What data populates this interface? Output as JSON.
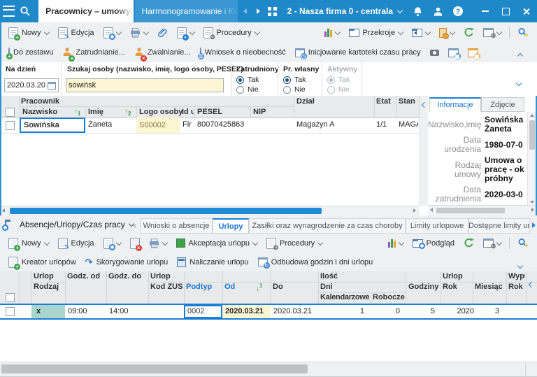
{
  "colors": {
    "titlebar": "#1e88c8",
    "accent": "#1a7fd4",
    "link_header": "#1976d2",
    "row_highlight_yellow": "#fcf6d4",
    "teal_cell": "#a9d6ce",
    "toolbar_bg": "#eef0f2",
    "grid_header_bg": "#e9eaeb",
    "sort_green": "#2f9e4e"
  },
  "titlebar": {
    "tab_active": "Pracownicy – umowy(etaty)",
    "tab_inactive": "Harmonogramowanie i Kontrola RI",
    "company": "2 - Nasza firma 0 - centrala"
  },
  "toolbar_main": {
    "nowy": "Nowy",
    "edycja": "Edycja",
    "procedury": "Procedury",
    "przekroje": "Przekroje"
  },
  "actionbar_main": {
    "do_zestawu": "Do zestawu",
    "zatrudnianie": "Zatrudnianie...",
    "zwalnianie": "Zwalnianie...",
    "wniosek": "Wniosek o nieobecność",
    "inicjowanie": "Inicjowanie kartoteki czasu pracy"
  },
  "filters": {
    "na_dzien": {
      "label": "Na dzień",
      "value": "2020.03.20"
    },
    "szukaj": {
      "label": "Szukaj osoby (nazwisko, imię, logo osoby, PESEL)",
      "value": "sowińsk"
    },
    "zatrudniony": {
      "label": "Zatrudniony",
      "tak": "Tak",
      "nie": "Nie",
      "selected": "Tak"
    },
    "pr_wlasny": {
      "label": "Pr. własny",
      "tak": "Tak",
      "nie": "Nie",
      "selected": "Tak"
    },
    "aktywny": {
      "label": "Aktywny",
      "tak": "Tak",
      "nie": "Nie",
      "selected": "Tak",
      "disabled": true
    }
  },
  "employees_grid": {
    "group_header": "Pracownik",
    "col_nazwisko": "Nazwisko",
    "col_imie": "Imię",
    "col_logo": "Logo osoby",
    "col_id": "Id u",
    "col_pesel": "PESEL",
    "col_nip": "NIP",
    "col_dzial": "Dział",
    "col_etat": "Etat",
    "col_stan": "Stan",
    "sort1": "1",
    "sort2": "2",
    "row": {
      "nazwisko": "Sowińska",
      "imie": "Żaneta",
      "logo": "S00002",
      "id": "Fir",
      "pesel": "80070425863",
      "nip": "",
      "dzial": "Magazyn A",
      "etat": "1/1",
      "stan": "MAGAZ"
    }
  },
  "info_panel": {
    "tab_informacje": "Informacje",
    "tab_zdjecie": "Zdjęcie",
    "fields": [
      {
        "label": "Nazwisko,imię",
        "value": "Sowińska Żaneta"
      },
      {
        "label": "Data urodzenia",
        "value": "1980-07-0"
      },
      {
        "label": "Rodzaj umowy",
        "value": "Umowa o pracę - ok próbny"
      },
      {
        "label": "Data zatrudnienia",
        "value": "2020-03-0"
      }
    ]
  },
  "bottom_section": {
    "title": "Absencje/Urlopy/Czas pracy",
    "tabs": [
      "Wnioski o absencje",
      "Urlopy",
      "Zasiłki oraz wynagrodzenie za czas choroby",
      "Limity urlopowe",
      "Dostępne limity ur"
    ],
    "active_tab": "Urlopy"
  },
  "toolbar_bottom": {
    "nowy": "Nowy",
    "edycja": "Edycja",
    "akceptacja": "Akceptacja urlopu",
    "procedury": "Procedury",
    "podglad": "Podgląd"
  },
  "actionbar_bottom": {
    "kreator": "Kreator urlopów",
    "skorygowanie": "Skorygowanie urlopu",
    "naliczanie": "Naliczanie urlopu",
    "odbudowa": "Odbudowa godzin i dni urlopu"
  },
  "vacations_grid": {
    "g_urlop1": "Urlop",
    "col_rodzaj": "Rodzaj",
    "col_godz_od": "Godz. od",
    "col_godz_do": "Godz. do",
    "g_urlop2": "Urlop",
    "col_kod_zus": "Kod ZUS",
    "col_podtyp": "Podtyp",
    "col_od": "Od",
    "sort_od": "1",
    "col_do": "Do",
    "g_ilosc": "Ilość",
    "col_dni": "Dni",
    "col_kalendarzowe": "Kalendarzowe",
    "col_robocze": "Robocze",
    "col_godziny": "Godziny",
    "g_urlop3": "Urlop",
    "col_rok": "Rok",
    "col_miesiac": "Miesiąc",
    "g_wyplata": "Wypła",
    "col_rok2": "Rok",
    "row": {
      "rodzaj": "x",
      "godz_od": "09:00",
      "godz_do": "14:00",
      "kod_zus": "",
      "podtyp": "0002",
      "od": "2020.03.21",
      "do": "2020.03.21",
      "kalendarzowe": "1",
      "robocze": "0",
      "godziny": "5",
      "rok": "2020",
      "miesiac": "3",
      "rok_wyplata": ""
    }
  }
}
